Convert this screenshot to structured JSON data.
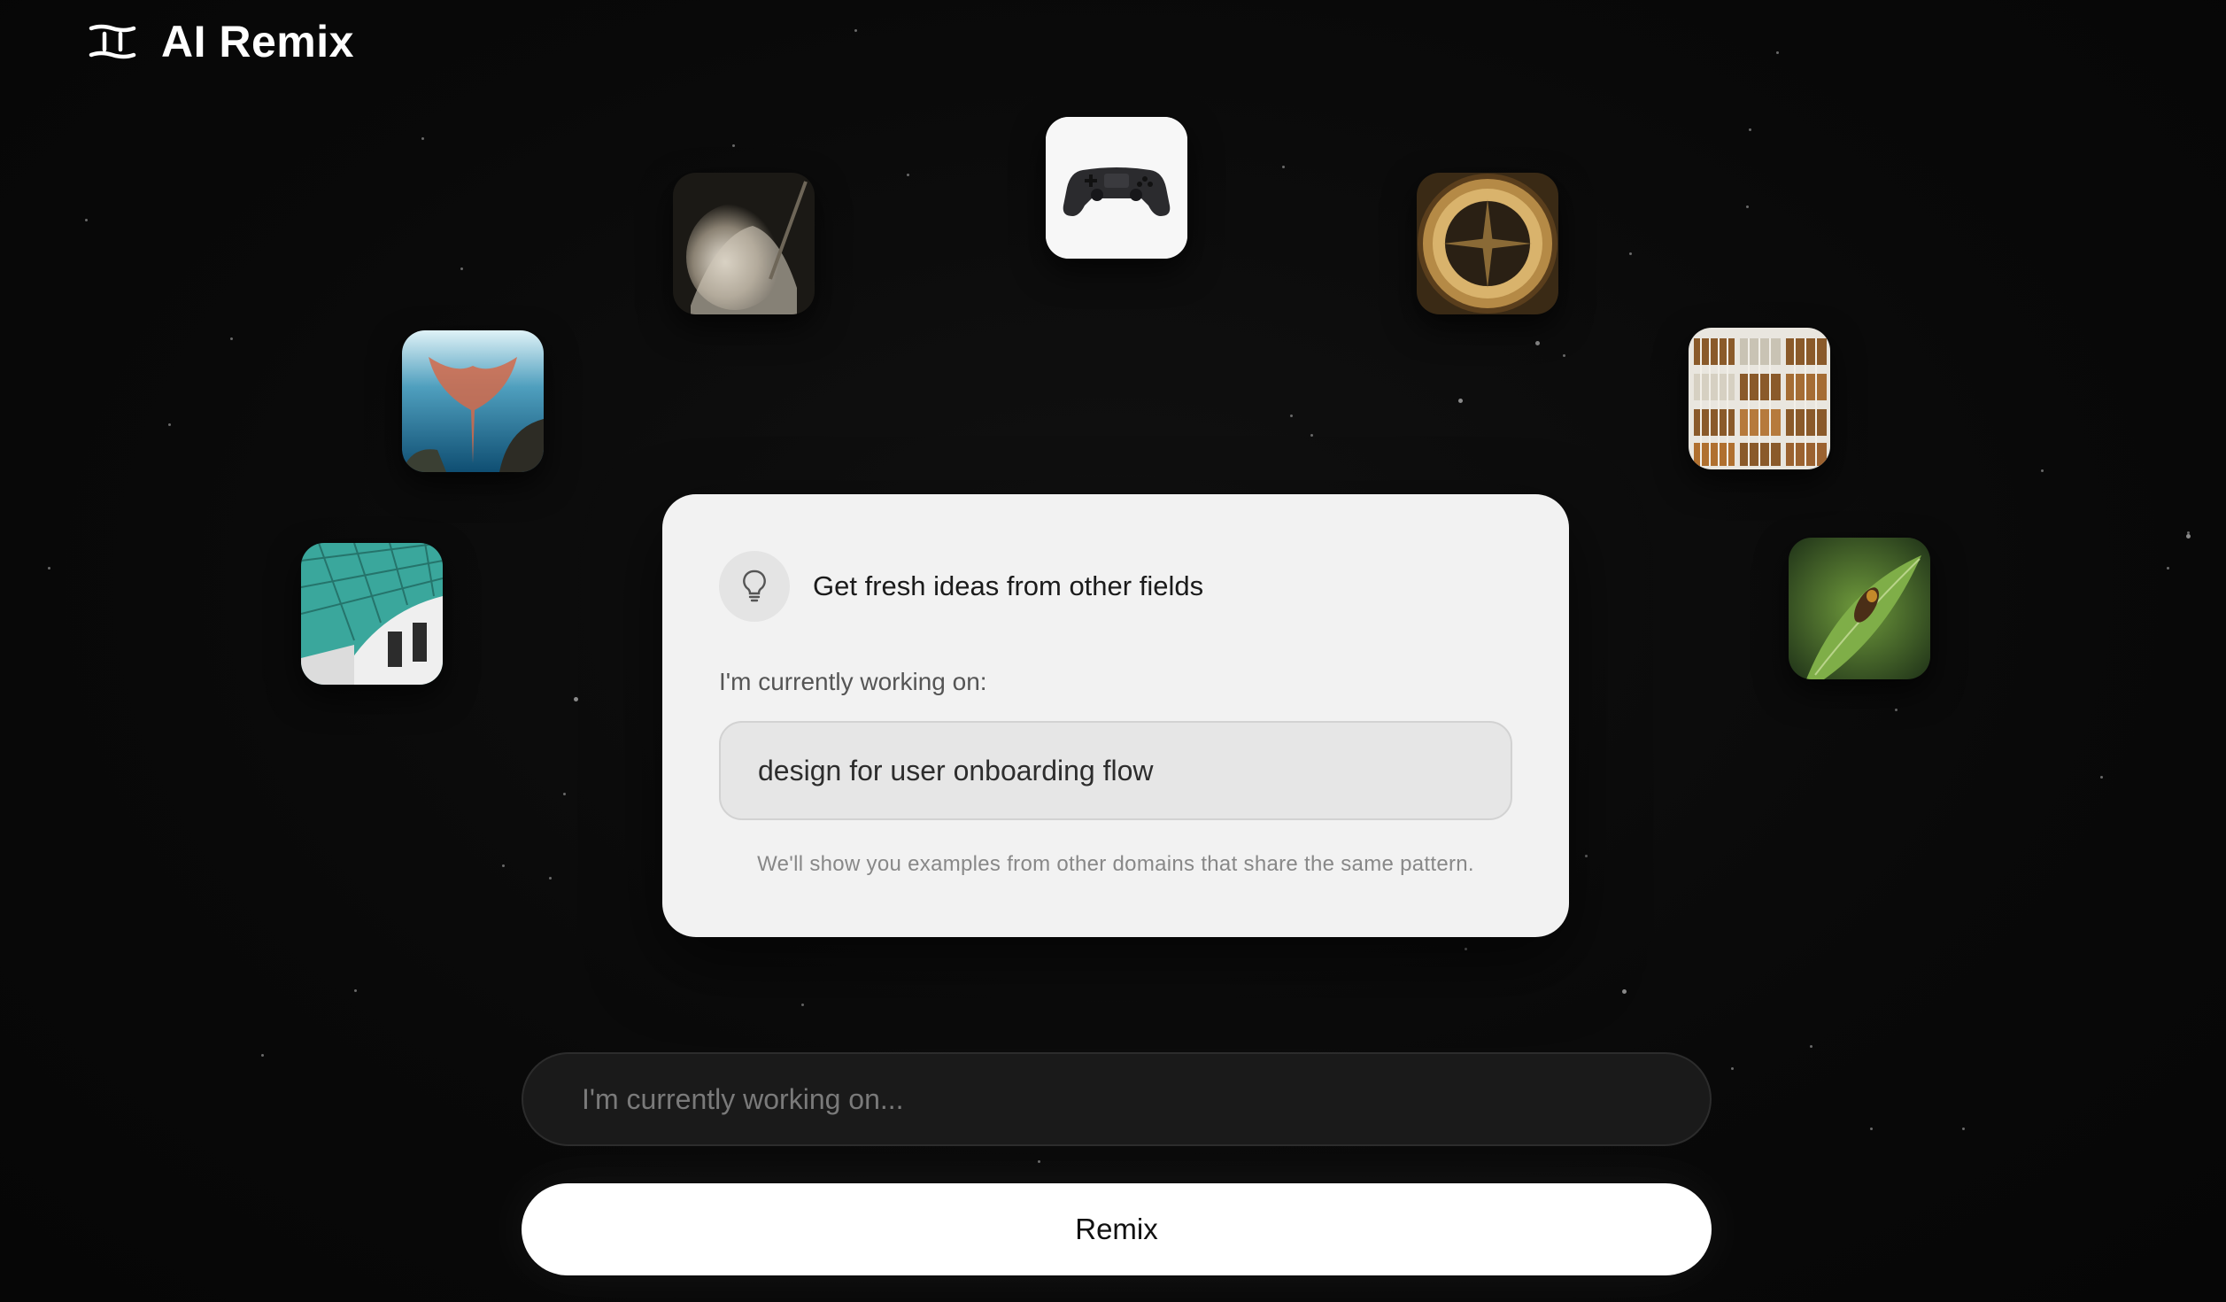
{
  "app": {
    "title": "AI Remix",
    "logo_icon": "remix-logo-icon"
  },
  "tiles": [
    {
      "name": "sculpture-image",
      "icon": "statue-photo"
    },
    {
      "name": "gamepad-image",
      "icon": "game-controller"
    },
    {
      "name": "compass-image",
      "icon": "compass-photo"
    },
    {
      "name": "coral-reef-image",
      "icon": "sea-fan-photo"
    },
    {
      "name": "library-shelves-image",
      "icon": "bookshelf-photo"
    },
    {
      "name": "glass-roof-image",
      "icon": "atrium-roof-photo"
    },
    {
      "name": "insect-leaf-image",
      "icon": "bee-on-leaf-photo"
    }
  ],
  "card": {
    "title": "Get fresh ideas from other fields",
    "icon": "lightbulb-icon",
    "label": "I'm currently working on:",
    "example_value": "design for user onboarding flow",
    "note": "We'll show you examples from other domains that share the same pattern."
  },
  "prompt": {
    "placeholder": "I'm currently working on..."
  },
  "actions": {
    "remix_label": "Remix"
  },
  "colors": {
    "background": "#0a0a0a",
    "card": "#f2f2f2",
    "button": "#ffffff"
  }
}
